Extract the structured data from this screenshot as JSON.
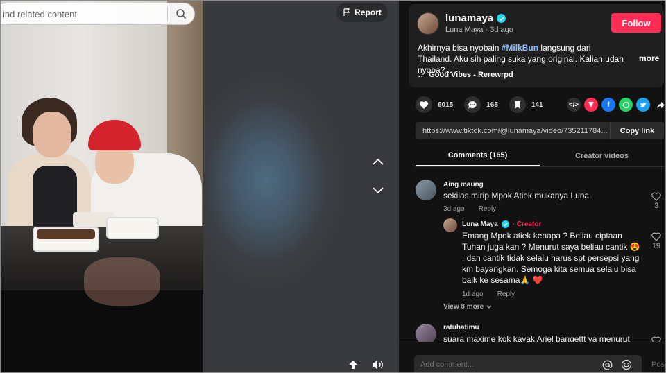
{
  "search": {
    "placeholder": "Find related content",
    "value": "ind related content"
  },
  "video": {
    "report_label": "Report"
  },
  "post": {
    "username": "lunamaya",
    "display_name": "Luna Maya",
    "age": "3d ago",
    "follow_label": "Follow",
    "caption_pre": "Akhirnya bisa nyobain ",
    "hashtag": "#MilkBun",
    "caption_post": " langsung dari Thailand. Aku sih paling suka yang original. Kalian udah nyoba?...",
    "more_label": "more",
    "music": "Good Vibes - Rerewrpd",
    "likes": "6015",
    "comments_count": "165",
    "saves": "141",
    "link": "https://www.tiktok.com/@lunamaya/video/735211784...",
    "copy_label": "Copy link",
    "share_colors": {
      "embed": "#2f2f2f",
      "friends": "#fe2c55",
      "facebook": "#1877f2",
      "whatsapp": "#25d366",
      "twitter": "#1da1f2"
    }
  },
  "tabs": {
    "comments": "Comments (165)",
    "creator": "Creator videos"
  },
  "comments": [
    {
      "user": "Aing maung",
      "text": "sekilas mirip Mpok Atiek mukanya Luna",
      "time": "3d ago",
      "reply": "Reply",
      "likes": "3",
      "replies": [
        {
          "user": "Luna Maya",
          "badge": "Creator",
          "text": "Emang Mpok atiek kenapa ? Beliau ciptaan Tuhan juga kan ? Menurut saya beliau cantik 😍 , dan cantik tidak selalu harus spt persepsi yang km bayangkan. Semoga kita semua selalu bisa baik ke sesama🙏 ❤️",
          "time": "1d ago",
          "reply": "Reply",
          "likes": "19"
        }
      ],
      "view_more": "View 8 more"
    },
    {
      "user": "ratuhatimu",
      "text": "suara maxime kok kayak Ariel bangettt ya menurut"
    }
  ],
  "composer": {
    "placeholder": "Add comment...",
    "post_label": "Post"
  }
}
